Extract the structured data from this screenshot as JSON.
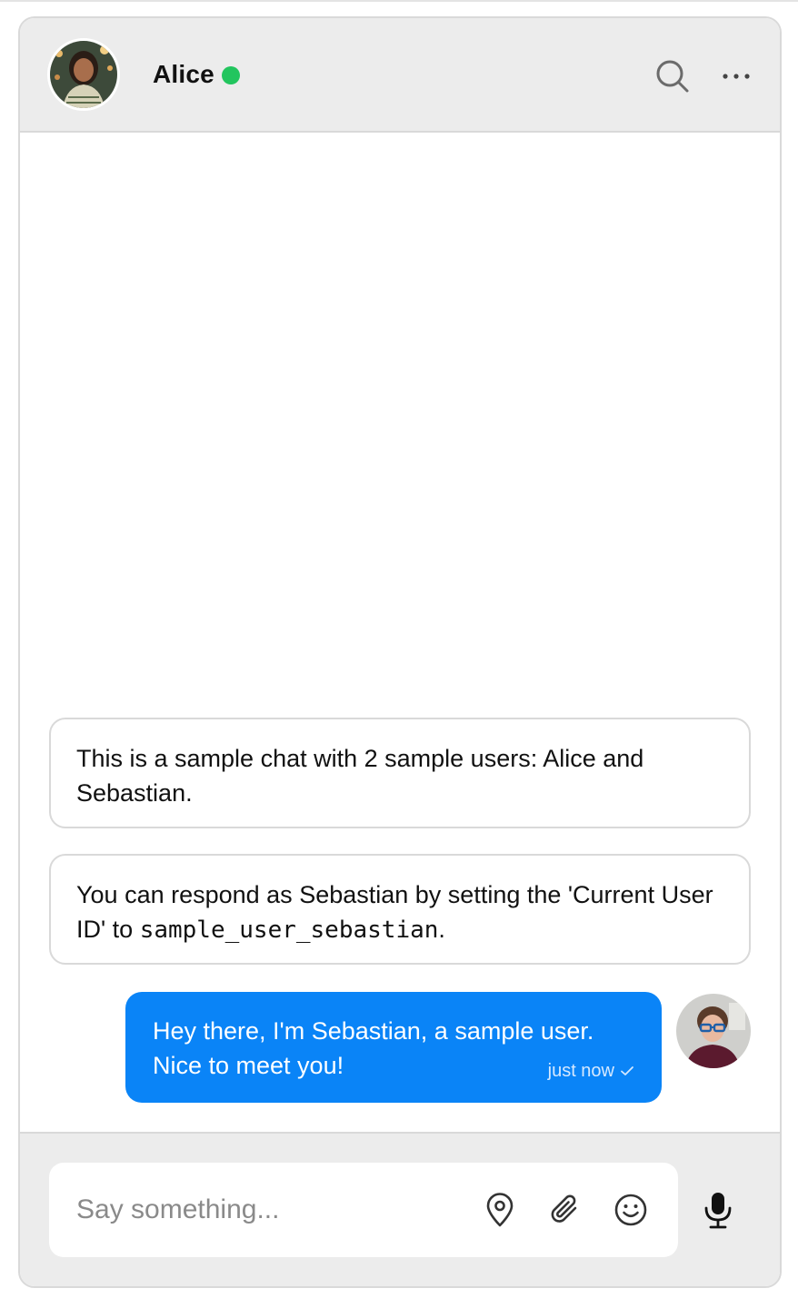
{
  "header": {
    "contact_name": "Alice",
    "status": "online",
    "status_color": "#22c55e"
  },
  "messages": {
    "system": [
      {
        "text": "This is a sample chat with 2 sample users: Alice and Sebastian."
      },
      {
        "text_before": "You can respond as Sebastian by setting the 'Current User ID' to ",
        "code": "sample_user_sebastian",
        "text_after": "."
      }
    ],
    "outgoing": {
      "text": "Hey there, I'm Sebastian, a sample user. Nice to meet you!",
      "time": "just now",
      "receipt_icon": "check-icon",
      "bubble_color": "#0a84f7"
    }
  },
  "composer": {
    "placeholder": "Say something...",
    "icons": [
      "location-pin-icon",
      "paperclip-icon",
      "smiley-icon",
      "microphone-icon"
    ]
  }
}
